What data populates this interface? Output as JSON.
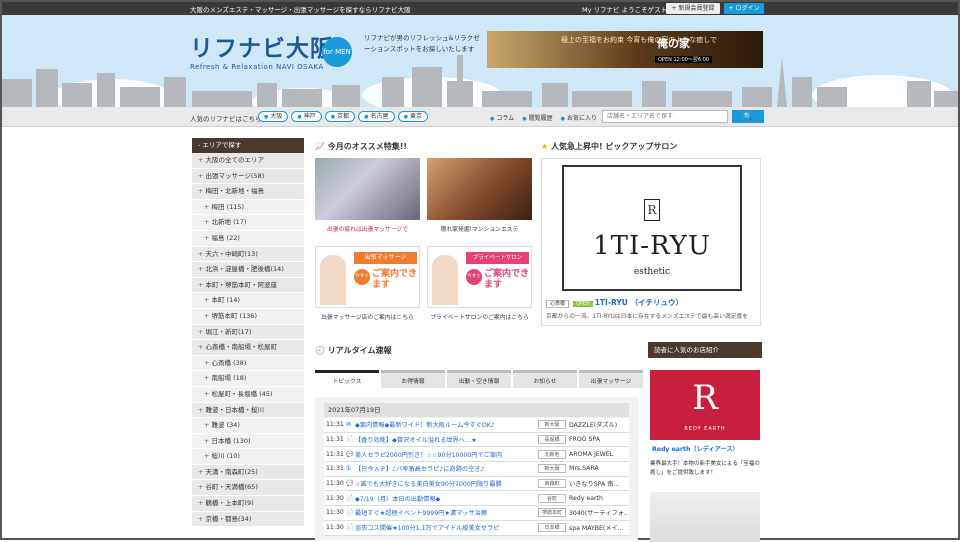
{
  "topbar": {
    "tagline": "大阪のメンズエステ・マッサージ・出張マッサージを探すならリフナビ大阪",
    "welcome": "My リフナビ ようこそゲストさん",
    "register": "+ 新規会員登録",
    "login": "+ ログイン"
  },
  "brand": {
    "name": "リフナビ大阪",
    "sub": "Refresh & Relaxation NAVI OSAKA",
    "badge": "for MEN",
    "intro": "リフナビが男のリフレッシュ&リラクゼーションスポットをお探しいたします"
  },
  "banner": {
    "copy": "極上の至福をお約束 今宵も俺の家のような癒しで",
    "shop": "俺の家",
    "hours": "OPEN 12:00～翌6:00"
  },
  "nav": {
    "label": "人気のリフナビはこちら",
    "cities": [
      "大阪",
      "神戸",
      "京都",
      "名古屋",
      "東京"
    ],
    "links": [
      "コラム",
      "閲覧履歴",
      "お気に入り"
    ],
    "search_placeholder": "店舗名・エリア名で探す",
    "search_btn": "🔍"
  },
  "sidebar": {
    "title": "- エリアで探す",
    "items": [
      {
        "label": "大阪の全てのエリア",
        "sub": false
      },
      {
        "label": "出張マッサージ(58)",
        "sub": false
      },
      {
        "label": "梅田・北新地・福島",
        "sub": false
      },
      {
        "label": "梅田 (115)",
        "sub": true
      },
      {
        "label": "北新地 (17)",
        "sub": true
      },
      {
        "label": "福島 (22)",
        "sub": true
      },
      {
        "label": "天六・中崎町(13)",
        "sub": false
      },
      {
        "label": "北浜・淀屋橋・肥後橋(14)",
        "sub": false
      },
      {
        "label": "本町・堺筋本町・阿波座",
        "sub": false
      },
      {
        "label": "本町 (14)",
        "sub": true
      },
      {
        "label": "堺筋本町 (136)",
        "sub": true
      },
      {
        "label": "堀江・新町(17)",
        "sub": false
      },
      {
        "label": "心斎橋・南船場・松屋町",
        "sub": false
      },
      {
        "label": "心斎橋 (38)",
        "sub": true
      },
      {
        "label": "南船場 (18)",
        "sub": true
      },
      {
        "label": "松屋町・長堀橋 (45)",
        "sub": true
      },
      {
        "label": "難波・日本橋・桜川",
        "sub": false
      },
      {
        "label": "難波 (34)",
        "sub": true
      },
      {
        "label": "日本橋 (130)",
        "sub": true
      },
      {
        "label": "桜川 (10)",
        "sub": true
      },
      {
        "label": "天満・南森町(25)",
        "sub": false
      },
      {
        "label": "谷町・天満橋(65)",
        "sub": false
      },
      {
        "label": "鶴橋・上本町(9)",
        "sub": false
      },
      {
        "label": "京橋・都島(34)",
        "sub": false
      }
    ]
  },
  "osusume": {
    "title": "今月のオススメ特集!!",
    "tiles": [
      "出張の疲れは出張マッサージで",
      "隠れ家発掘!マンションエステ",
      "出張マッサージ店のご案内はこちら",
      "プライベートサロンのご案内はこちら"
    ],
    "promo1": {
      "head": "出張マッサージ",
      "now": "今すぐ",
      "main": "ご案内できます"
    },
    "promo2": {
      "head": "プライベートサロン",
      "now": "今すぐ",
      "main": "ご案内できます"
    }
  },
  "pickup": {
    "title": "人気急上昇中! ピックアップサロン",
    "logo": "1TI-RYU",
    "logo_sub": "esthetic",
    "area": "心斎橋",
    "status": "OPEN",
    "name": "1TI-RYU （イチリュウ）",
    "desc": "京都からの一流。1TI-RYUは日本に存在するメンズエステで最も高い満足度を"
  },
  "realtime": {
    "title": "リアルタイム速報",
    "tabs": [
      "トピックス",
      "お得情報",
      "出勤・空き情報",
      "お知らせ",
      "出張マッサージ"
    ],
    "date": "2021年07月19日",
    "rows": [
      {
        "time": "11:31",
        "msg": "◆案内情報◆最新ワイド！新大阪ルーム今すぐOK♪",
        "area": "新大阪",
        "shop": "DAZZLE(ダズル)"
      },
      {
        "time": "11:31",
        "msg": "【香り効能】◆贅沢オイル溢れる世界へ…★",
        "area": "長堀橋",
        "shop": "FROG SPA"
      },
      {
        "time": "11:31",
        "msg": "美人セラピ2000円引き！☆☆90分10000円でご案内",
        "area": "北新地",
        "shop": "AROMA JEWEL"
      },
      {
        "time": "11:31",
        "msg": "【只今入ヂ】♪バ率激高セラピ♪に奇跡の空き♪",
        "area": "新大阪",
        "shop": "Mrs.SARA"
      },
      {
        "time": "11:30",
        "msg": "☆誰でも大好きになる美白美女90分7000円限り最勝",
        "area": "南森町",
        "shop": "いきなりSPA 南..."
      },
      {
        "time": "11:30",
        "msg": "◆7/19（月）本日の出勤情報◆",
        "area": "谷町",
        "shop": "Redy earth"
      },
      {
        "time": "11:30",
        "msg": "最短すぐ★超極イベント9999円★濃マッサ治療",
        "area": "堺筋本町",
        "shop": "3040(サーティフォ..."
      },
      {
        "time": "11:30",
        "msg": "浴衣コス開催★100分1.1万でアイドル級美女セラピ",
        "area": "日本橋",
        "shop": "spa MAYBE(メイ..."
      }
    ]
  },
  "reader": {
    "title": "読者に人気のお店紹介",
    "logo": "R",
    "logo_sub": "REDY EARTH",
    "name": "Redy earth（レディアース）",
    "desc": "業界最大手！本物の新手美女による「至福の癒し」をご提供致します！"
  }
}
